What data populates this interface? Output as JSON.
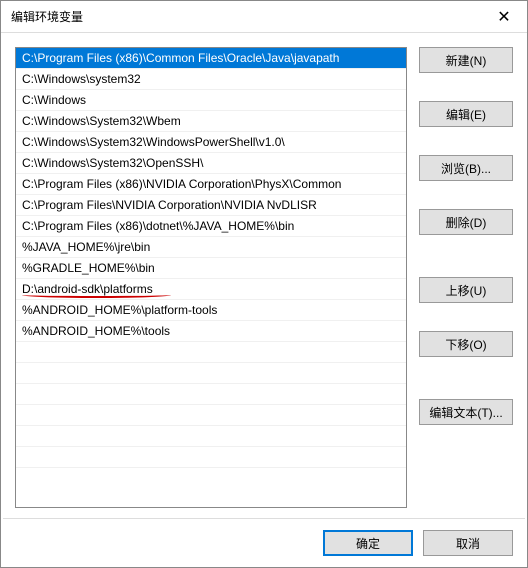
{
  "title": "编辑环境变量",
  "list": {
    "items": [
      "C:\\Program Files (x86)\\Common Files\\Oracle\\Java\\javapath",
      "C:\\Windows\\system32",
      "C:\\Windows",
      "C:\\Windows\\System32\\Wbem",
      "C:\\Windows\\System32\\WindowsPowerShell\\v1.0\\",
      "C:\\Windows\\System32\\OpenSSH\\",
      "C:\\Program Files (x86)\\NVIDIA Corporation\\PhysX\\Common",
      "C:\\Program Files\\NVIDIA Corporation\\NVIDIA NvDLISR",
      "C:\\Program Files (x86)\\dotnet\\%JAVA_HOME%\\bin",
      "%JAVA_HOME%\\jre\\bin",
      "%GRADLE_HOME%\\bin",
      "D:\\android-sdk\\platforms",
      "%ANDROID_HOME%\\platform-tools",
      "%ANDROID_HOME%\\tools"
    ],
    "selected_index": 0,
    "underlined_index": 11
  },
  "buttons": {
    "new": "新建(N)",
    "edit": "编辑(E)",
    "browse": "浏览(B)...",
    "delete": "删除(D)",
    "move_up": "上移(U)",
    "move_down": "下移(O)",
    "edit_text": "编辑文本(T)..."
  },
  "footer": {
    "ok": "确定",
    "cancel": "取消"
  }
}
